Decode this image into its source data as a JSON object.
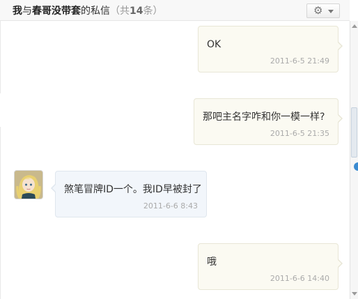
{
  "header": {
    "title_me": "我",
    "title_with": "与",
    "title_name": "春哥没带套",
    "title_suffix": "的私信",
    "count_open": "（共",
    "count_number": "14",
    "count_close": "条）",
    "settings_icon": "gear-icon"
  },
  "messages": [
    {
      "direction": "outgoing",
      "text": "OK",
      "time": "2011-6-5 21:49"
    },
    {
      "direction": "outgoing",
      "text": "那吧主名字咋和你一模一样?",
      "time": "2011-6-5 21:35"
    },
    {
      "direction": "incoming",
      "text": "煞笔冒牌ID一个。我ID早被封了",
      "time": "2011-6-6 8:43"
    },
    {
      "direction": "outgoing",
      "text": "哦",
      "time": "2011-6-6 14:40"
    }
  ],
  "colors": {
    "outgoing_bubble": "#fbfaf2",
    "incoming_bubble": "#f2f6fb",
    "timestamp": "#aaaaaa",
    "scroll_badge": "#3a8bd1"
  }
}
